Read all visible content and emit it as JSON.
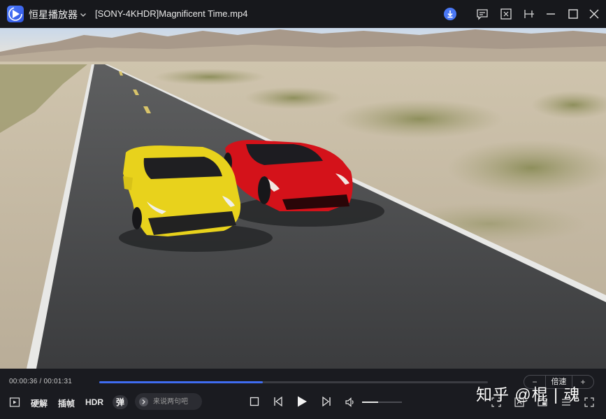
{
  "titlebar": {
    "app_name": "恒星播放器",
    "file_title": "[SONY-4KHDR]Magnificent Time.mp4",
    "icons": [
      "app-logo-icon",
      "chevron-down-icon",
      "download-icon",
      "message-icon",
      "fullscreen-exit-icon",
      "pin-icon",
      "minimize-icon",
      "maximize-icon",
      "close-icon"
    ]
  },
  "controls": {
    "time_current": "00:00:36",
    "time_separator": " / ",
    "time_total": "00:01:31",
    "progress": 0.42,
    "speed": {
      "minus": "−",
      "label": "倍速",
      "plus": "+"
    },
    "hardware_decode": "硬解",
    "frame_interp": "插帧",
    "hdr": "HDR",
    "danmu_badge": "弹",
    "danmu_placeholder": "来说两句吧",
    "volume": 0.4
  },
  "watermark": "知乎 @棍 | 魂",
  "colors": {
    "accent": "#3f6cf0",
    "background": "#17181c"
  }
}
